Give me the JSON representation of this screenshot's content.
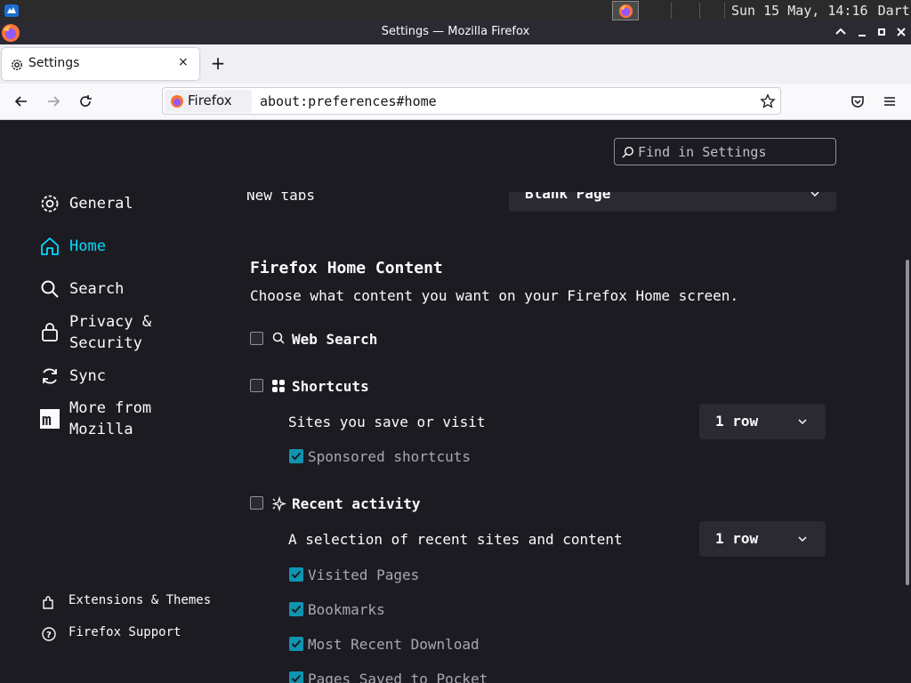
{
  "system_panel": {
    "clock": "Sun 15 May, 14:16",
    "user": "Dartz"
  },
  "window": {
    "title": "Settings — Mozilla Firefox"
  },
  "tab": {
    "label": "Settings",
    "close": "×",
    "new_tab": "+"
  },
  "navbar": {
    "identity_label": "Firefox",
    "url": "about:preferences#home"
  },
  "search": {
    "placeholder": "Find in Settings"
  },
  "sidebar": {
    "items": [
      {
        "label": "General",
        "icon": "gear-icon"
      },
      {
        "label": "Home",
        "icon": "home-icon",
        "selected": true
      },
      {
        "label": "Search",
        "icon": "search-icon"
      },
      {
        "label": "Privacy &\nSecurity",
        "icon": "lock-icon"
      },
      {
        "label": "Sync",
        "icon": "sync-icon"
      },
      {
        "label": "More from\nMozilla",
        "icon": "mozilla-m-icon"
      }
    ],
    "footer": [
      {
        "label": "Extensions & Themes",
        "icon": "puzzle-icon"
      },
      {
        "label": "Firefox Support",
        "icon": "help-icon"
      }
    ]
  },
  "main": {
    "new_tabs_label": "New tabs",
    "new_tabs_value": "Blank Page",
    "section_title": "Firefox Home Content",
    "section_desc": "Choose what content you want on your Firefox Home screen.",
    "web_search": {
      "label": "Web Search",
      "checked": false
    },
    "shortcuts": {
      "label": "Shortcuts",
      "checked": false,
      "sub_label": "Sites you save or visit",
      "rows": "1 row",
      "sponsored": {
        "label": "Sponsored shortcuts",
        "checked": true
      }
    },
    "recent": {
      "label": "Recent activity",
      "checked": false,
      "sub_label": "A selection of recent sites and content",
      "rows": "1 row",
      "options": [
        {
          "label": "Visited Pages",
          "checked": true
        },
        {
          "label": "Bookmarks",
          "checked": true
        },
        {
          "label": "Most Recent Download",
          "checked": true
        },
        {
          "label": "Pages Saved to Pocket",
          "checked": true
        }
      ]
    }
  },
  "colors": {
    "background": "#1c1b22",
    "accent": "#00ddff",
    "checkbox": "#0e94b0",
    "text": "#fbfbfe"
  }
}
